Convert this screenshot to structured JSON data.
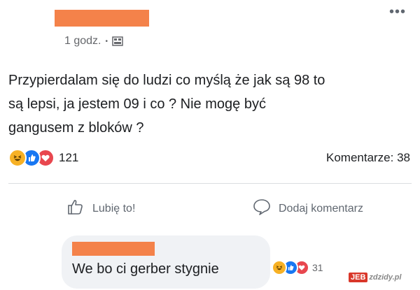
{
  "post": {
    "time": "1 godz.",
    "separator": "•",
    "audience_icon": "public-globe-icon",
    "text": "Przypierdalam się do ludzi co myślą że jak są 98 to\nsą lepsi, ja jestem 09 i co ? Nie mogę być\ngangusem z bloków ?",
    "reactions": [
      "haha",
      "like",
      "love"
    ],
    "reaction_count": "121",
    "comments_label": "Komentarze: 38"
  },
  "actions": {
    "like_label": "Lubię to!",
    "comment_label": "Dodaj komentarz"
  },
  "comment": {
    "text": "We bo ci gerber stygnie",
    "reaction_count": "31"
  },
  "watermark": {
    "part1": "JEB",
    "part2": "zdzidy.pl"
  },
  "colors": {
    "redaction": "#f4824a",
    "like_blue": "#1877f2",
    "haha_yellow": "#f7b125",
    "love_red": "#e8474f"
  }
}
